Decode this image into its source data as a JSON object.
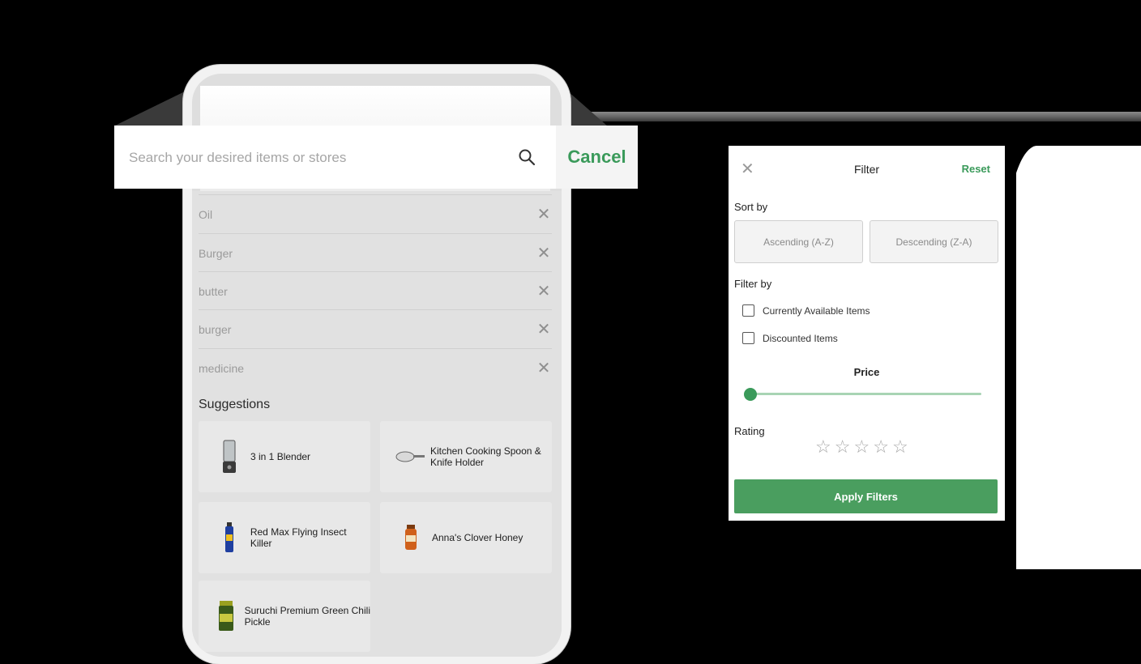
{
  "search": {
    "placeholder": "Search your desired items or stores",
    "cancel_label": "Cancel"
  },
  "history": [
    {
      "text": "Oil"
    },
    {
      "text": "Burger"
    },
    {
      "text": "butter"
    },
    {
      "text": "burger"
    },
    {
      "text": "medicine"
    }
  ],
  "suggestions": {
    "title": "Suggestions",
    "items": [
      {
        "name": "3 in 1 Blender",
        "icon": "blender-icon"
      },
      {
        "name": "Kitchen Cooking Spoon & Knife Holder",
        "icon": "spoon-holder-icon"
      },
      {
        "name": "Red Max Flying Insect Killer",
        "icon": "insect-spray-icon"
      },
      {
        "name": "Anna's Clover Honey",
        "icon": "honey-jar-icon"
      },
      {
        "name": "Suruchi Premium Green Chili Pickle",
        "icon": "pickle-jar-icon"
      }
    ]
  },
  "filter": {
    "title": "Filter",
    "reset_label": "Reset",
    "sort_by_label": "Sort by",
    "sort_options": [
      "Ascending (A-Z)",
      "Descending (Z-A)"
    ],
    "filter_by_label": "Filter by",
    "checkboxes": [
      {
        "label": "Currently Available Items",
        "checked": false
      },
      {
        "label": "Discounted Items",
        "checked": false
      }
    ],
    "price_label": "Price",
    "price_slider_value": 0,
    "rating_label": "Rating",
    "rating_value": 0,
    "rating_max": 5,
    "apply_label": "Apply Filters"
  },
  "colors": {
    "accent_green": "#3a9a5a",
    "button_green": "#4a9e5f"
  }
}
